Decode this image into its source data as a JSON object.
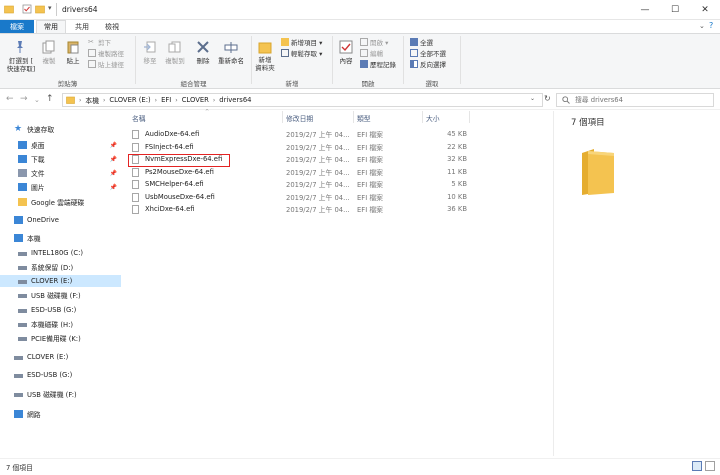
{
  "window": {
    "title": "drivers64",
    "minimize": "—",
    "maximize": "☐",
    "close": "✕"
  },
  "tabs": [
    "檔案",
    "常用",
    "共用",
    "檢視"
  ],
  "ribbon": {
    "groups": {
      "clipboard": "剪貼簿",
      "organize": "組合管理",
      "new": "新增",
      "open": "開啟",
      "select": "選取"
    },
    "pin_quick": "釘選到 [\n快速存取]",
    "copy": "複製",
    "paste": "貼上",
    "cut": "剪下",
    "copy_path": "複製路徑",
    "paste_shortcut": "貼上捷徑",
    "move_to": "移至",
    "copy_to": "複製到",
    "delete": "刪除",
    "rename": "重新命名",
    "new_folder": "新增\n資料夾",
    "new_item": "新增項目 ▾",
    "easy_access": "輕鬆存取 ▾",
    "properties": "內容",
    "open_btn": "開啟 ▾",
    "edit": "編輯",
    "history": "歷程記錄",
    "select_all": "全選",
    "select_none": "全部不選",
    "invert": "反向選擇"
  },
  "address": {
    "crumbs": [
      "本機",
      "CLOVER (E:)",
      "EFI",
      "CLOVER",
      "drivers64"
    ],
    "search_placeholder": "搜尋 drivers64"
  },
  "nav": [
    {
      "label": "快速存取",
      "icon": "star-icon",
      "pinned": false,
      "selected": false
    },
    {
      "label": "桌面",
      "icon": "desktop-icon",
      "pinned": true,
      "selected": false
    },
    {
      "label": "下載",
      "icon": "download-icon",
      "pinned": true,
      "selected": false
    },
    {
      "label": "文件",
      "icon": "document-icon",
      "pinned": true,
      "selected": false
    },
    {
      "label": "圖片",
      "icon": "picture-icon",
      "pinned": true,
      "selected": false
    },
    {
      "label": "Google 雲端硬碟",
      "icon": "folder-icon",
      "pinned": false,
      "selected": false
    },
    {
      "label": "OneDrive",
      "icon": "cloud-icon",
      "pinned": false,
      "selected": false
    },
    {
      "label": "本機",
      "icon": "computer-icon",
      "pinned": false,
      "selected": false
    },
    {
      "label": "INTEL180G (C:)",
      "icon": "drive-icon",
      "pinned": false,
      "selected": false
    },
    {
      "label": "系統保留 (D:)",
      "icon": "drive-icon",
      "pinned": false,
      "selected": false
    },
    {
      "label": "CLOVER (E:)",
      "icon": "drive-icon",
      "pinned": false,
      "selected": true
    },
    {
      "label": "USB 磁碟機 (F:)",
      "icon": "usb-drive-icon",
      "pinned": false,
      "selected": false
    },
    {
      "label": "ESD-USB (G:)",
      "icon": "usb-drive-icon",
      "pinned": false,
      "selected": false
    },
    {
      "label": "本機磁碟 (H:)",
      "icon": "drive-icon",
      "pinned": false,
      "selected": false
    },
    {
      "label": "PCIE備用碟 (K:)",
      "icon": "drive-icon",
      "pinned": false,
      "selected": false
    },
    {
      "label": "CLOVER (E:)",
      "icon": "drive-icon",
      "pinned": false,
      "selected": false
    },
    {
      "label": "ESD-USB (G:)",
      "icon": "usb-drive-icon",
      "pinned": false,
      "selected": false
    },
    {
      "label": "USB 磁碟機 (F:)",
      "icon": "usb-drive-icon",
      "pinned": false,
      "selected": false
    },
    {
      "label": "網路",
      "icon": "network-icon",
      "pinned": false,
      "selected": false
    }
  ],
  "columns": {
    "name": "名稱",
    "date": "修改日期",
    "type": "類型",
    "size": "大小"
  },
  "files": [
    {
      "name": "AudioDxe-64.efi",
      "date": "2019/2/7 上午 04...",
      "type": "EFI 檔案",
      "size": "45 KB"
    },
    {
      "name": "FSInject-64.efi",
      "date": "2019/2/7 上午 04...",
      "type": "EFI 檔案",
      "size": "22 KB"
    },
    {
      "name": "NvmExpressDxe-64.efi",
      "date": "2019/2/7 上午 04...",
      "type": "EFI 檔案",
      "size": "32 KB"
    },
    {
      "name": "Ps2MouseDxe-64.efi",
      "date": "2019/2/7 上午 04...",
      "type": "EFI 檔案",
      "size": "11 KB"
    },
    {
      "name": "SMCHelper-64.efi",
      "date": "2019/2/7 上午 04...",
      "type": "EFI 檔案",
      "size": "5 KB"
    },
    {
      "name": "UsbMouseDxe-64.efi",
      "date": "2019/2/7 上午 04...",
      "type": "EFI 檔案",
      "size": "10 KB"
    },
    {
      "name": "XhciDxe-64.efi",
      "date": "2019/2/7 上午 04...",
      "type": "EFI 檔案",
      "size": "36 KB"
    }
  ],
  "preview": {
    "count": "7 個項目"
  },
  "status": {
    "count": "7 個項目"
  },
  "colors": {
    "accent": "#1979ca",
    "highlight": "#e32323",
    "selected_bg": "#cce8ff",
    "folder": "#f4c350"
  }
}
